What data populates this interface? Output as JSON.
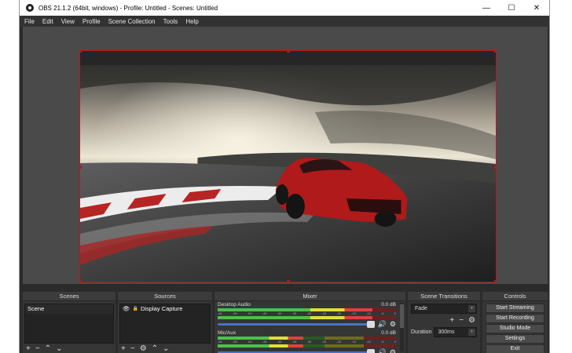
{
  "window": {
    "title": "OBS 21.1.2 (64bit, windows) - Profile: Untitled - Scenes: Untitled",
    "minimize": "—",
    "maximize": "☐",
    "close": "✕"
  },
  "menu": [
    "File",
    "Edit",
    "View",
    "Profile",
    "Scene Collection",
    "Tools",
    "Help"
  ],
  "docks": {
    "scenes": {
      "title": "Scenes",
      "items": [
        "Scene"
      ]
    },
    "sources": {
      "title": "Sources",
      "items": [
        "Display Capture"
      ]
    },
    "mixer": {
      "title": "Mixer",
      "channels": [
        {
          "name": "Desktop Audio",
          "db": "0.0 dB",
          "level": 0.87
        },
        {
          "name": "Mic/Aux",
          "db": "0.0 dB",
          "level": 0.48
        }
      ],
      "ticks": [
        "-60",
        "-55",
        "-50",
        "-45",
        "-40",
        "-35",
        "-30",
        "-25",
        "-20",
        "-15",
        "-10",
        "-5",
        "0"
      ]
    },
    "transitions": {
      "title": "Scene Transitions",
      "selected": "Fade",
      "duration_label": "Duration",
      "duration_value": "300ms"
    },
    "controls": {
      "title": "Controls",
      "buttons": [
        "Start Streaming",
        "Start Recording",
        "Studio Mode",
        "Settings",
        "Exit"
      ]
    }
  },
  "colors": {
    "selection_border": "#c01414",
    "volume_slider": "#4a72c4"
  }
}
